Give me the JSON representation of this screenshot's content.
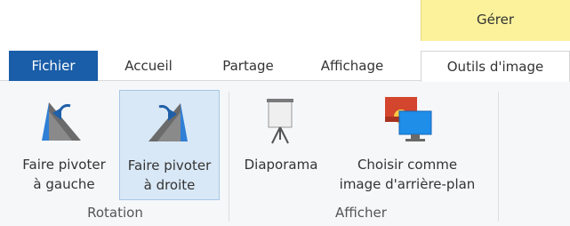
{
  "contextual_tab": {
    "label": "Gérer",
    "color": "#fbf29b"
  },
  "tabs": [
    {
      "label": "Fichier",
      "color": "#1a5da8"
    },
    {
      "label": "Accueil"
    },
    {
      "label": "Partage"
    },
    {
      "label": "Affichage"
    },
    {
      "label": "Outils d'image",
      "state": "active"
    }
  ],
  "groups": {
    "rotation": {
      "label": "Rotation",
      "buttons": {
        "rotate_left": {
          "line1": "Faire pivoter",
          "line2": "à gauche",
          "icon": "rotate-left-icon"
        },
        "rotate_right": {
          "line1": "Faire pivoter",
          "line2": "à droite",
          "icon": "rotate-right-icon",
          "state": "hovered"
        }
      }
    },
    "display": {
      "label": "Afficher",
      "buttons": {
        "slideshow": {
          "line1": "Diaporama",
          "icon": "projector-screen-icon"
        },
        "set_background": {
          "line1": "Choisir comme",
          "line2": "image d'arrière-plan",
          "icon": "desktop-background-icon"
        }
      }
    }
  }
}
